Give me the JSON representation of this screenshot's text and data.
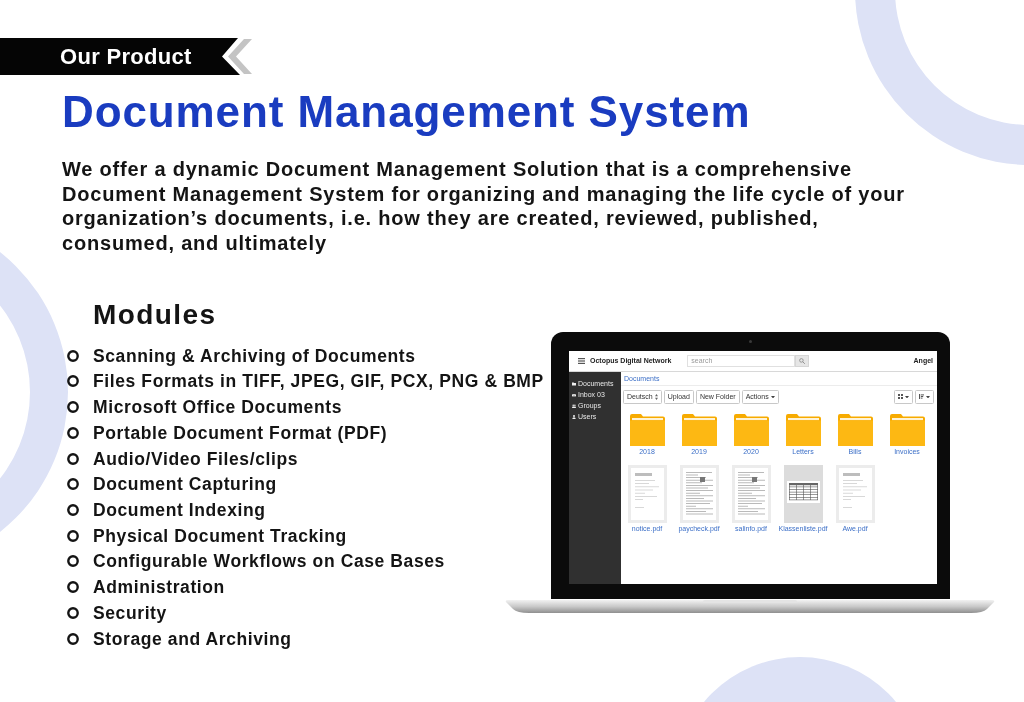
{
  "ribbon": {
    "label": "Our Product"
  },
  "title": "Document Management System",
  "intro": "We offer a dynamic Document Management Solution that is a comprehensive Document Management System for organizing and managing the life cycle of your organization’s documents, i.e. how they are created, reviewed, published, consumed, and ultimately",
  "modules": {
    "heading": "Modules",
    "items": [
      "Scanning & Archiving of Documents",
      "Files Formats in TIFF, JPEG, GIF, PCX, PNG & BMP",
      "Microsoft Office Documents",
      "Portable Document Format (PDF)",
      "Audio/Video Files/clips",
      "Document Capturing",
      "Document Indexing",
      "Physical Document Tracking",
      "Configurable Workflows on Case Bases",
      "Administration",
      "Security",
      "Storage and Archiving"
    ]
  },
  "laptop_app": {
    "app_title": "Octopus Digital Network",
    "search": {
      "placeholder": "search"
    },
    "user": "Angel",
    "sidebar": {
      "items": [
        "Documents",
        "Inbox 03",
        "Groups",
        "Users"
      ]
    },
    "breadcrumb": "Documents",
    "toolbar": {
      "language": "Deutsch",
      "buttons": [
        {
          "label": "Upload",
          "dropdown": false
        },
        {
          "label": "New Folder",
          "dropdown": false
        },
        {
          "label": "Actions",
          "dropdown": true
        }
      ]
    },
    "folders": [
      "2018",
      "2019",
      "2020",
      "Letters",
      "Bills",
      "Invoices"
    ],
    "files": [
      {
        "name": "notice.pdf",
        "kind": "letter"
      },
      {
        "name": "paycheck.pdf",
        "kind": "form"
      },
      {
        "name": "salinfo.pdf",
        "kind": "form"
      },
      {
        "name": "Klassenliste.pdf",
        "kind": "table"
      },
      {
        "name": "Awe.pdf",
        "kind": "letter"
      }
    ]
  }
}
